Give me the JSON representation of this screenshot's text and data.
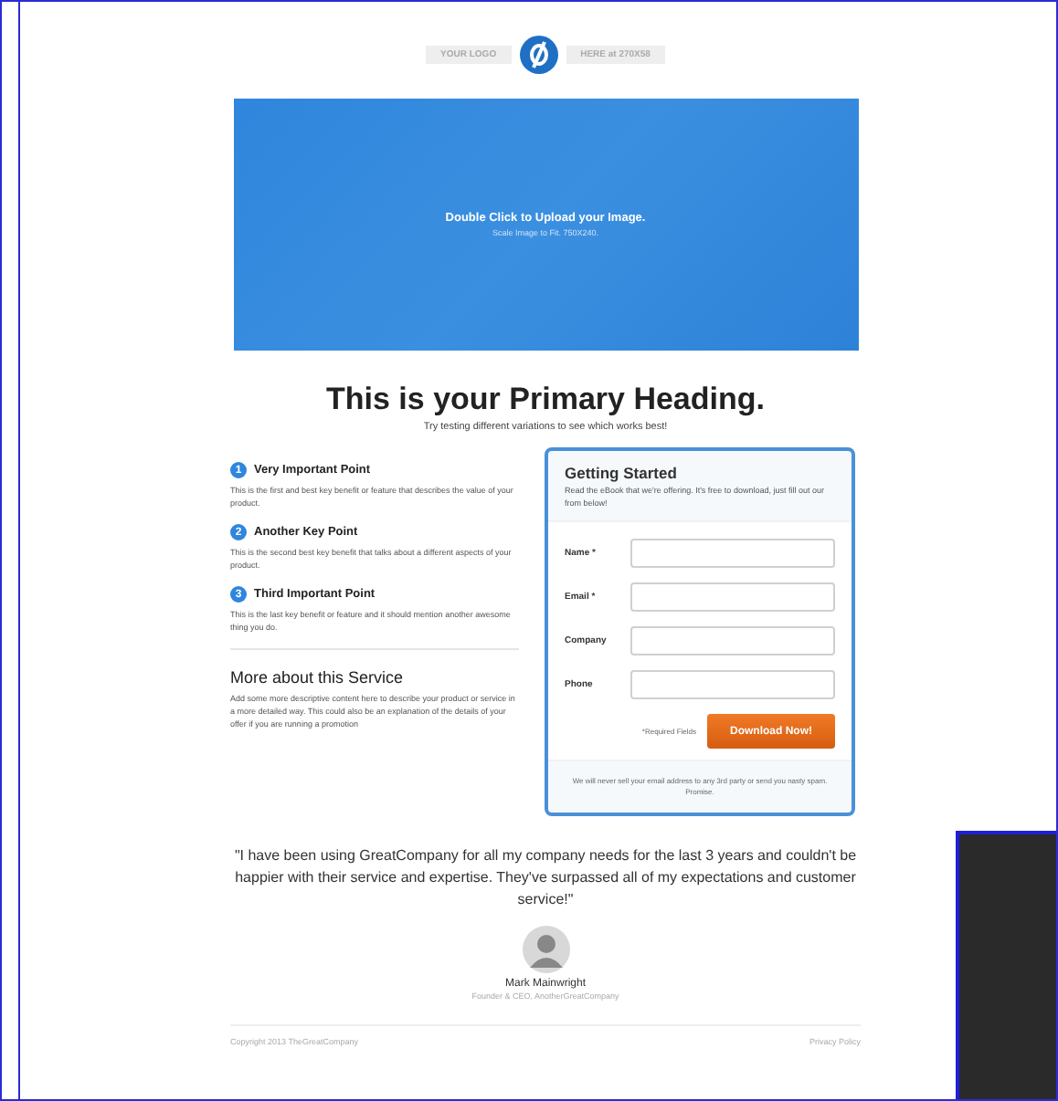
{
  "logo": {
    "left": "YOUR LOGO",
    "right": "HERE at 270X58"
  },
  "banner": {
    "title": "Double Click to Upload your Image.",
    "subtitle": "Scale Image to Fit. 750X240."
  },
  "heading": "This is your Primary Heading.",
  "subheading": "Try testing different variations to see which works best!",
  "points": [
    {
      "number": "1",
      "title": "Very Important Point",
      "text": "This is the first and best key benefit or feature that describes the value of your product."
    },
    {
      "number": "2",
      "title": "Another Key Point",
      "text": "This is the second best key benefit that talks about a different aspects of your product."
    },
    {
      "number": "3",
      "title": "Third Important Point",
      "text": "This is the last key benefit or feature and it should mention another awesome thing you do."
    }
  ],
  "more": {
    "title": "More about this Service",
    "text": "Add some more descriptive content here to describe your product or service in a more detailed way. This could also be an explanation of the details of your offer if you are running a promotion"
  },
  "form": {
    "title": "Getting Started",
    "intro": "Read the eBook that we're offering. It's free to download, just fill out our from below!",
    "fields": [
      {
        "label": "Name *"
      },
      {
        "label": "Email *"
      },
      {
        "label": "Company"
      },
      {
        "label": "Phone"
      }
    ],
    "required_note": "*Required Fields",
    "button": "Download Now!",
    "privacy": "We will never sell your email address to any 3rd party or send you nasty spam. Promise."
  },
  "testimonial": {
    "quote": "\"I have been using GreatCompany for all my company needs for the last 3 years and couldn't be happier with their service and expertise. They've surpassed all of my expectations and customer service!\"",
    "name": "Mark Mainwright",
    "role": "Founder & CEO, AnotherGreatCompany"
  },
  "footer": {
    "copyright": "Copyright 2013 TheGreatCompany",
    "link": "Privacy Policy"
  }
}
